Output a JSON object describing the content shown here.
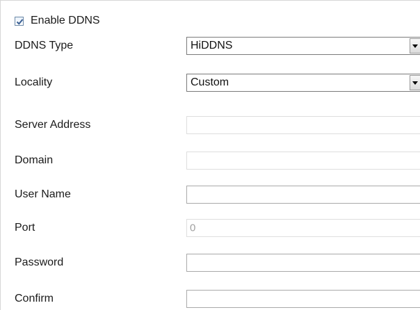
{
  "enable_ddns": {
    "label": "Enable DDNS",
    "checked": true
  },
  "fields": {
    "ddns_type": {
      "label": "DDNS Type",
      "value": "HiDDNS"
    },
    "locality": {
      "label": "Locality",
      "value": "Custom"
    },
    "server_address": {
      "label": "Server Address",
      "value": ""
    },
    "domain": {
      "label": "Domain",
      "value": ""
    },
    "user_name": {
      "label": "User Name",
      "value": ""
    },
    "port": {
      "label": "Port",
      "value": "0"
    },
    "password": {
      "label": "Password",
      "value": ""
    },
    "confirm": {
      "label": "Confirm",
      "value": ""
    }
  },
  "icons": {
    "checkbox_check": "check-icon",
    "dropdown_arrow": "chevron-down-icon"
  },
  "colors": {
    "check_mark": "#3a5f93",
    "border": "#a9a9a9",
    "disabled_border": "#dedede"
  }
}
